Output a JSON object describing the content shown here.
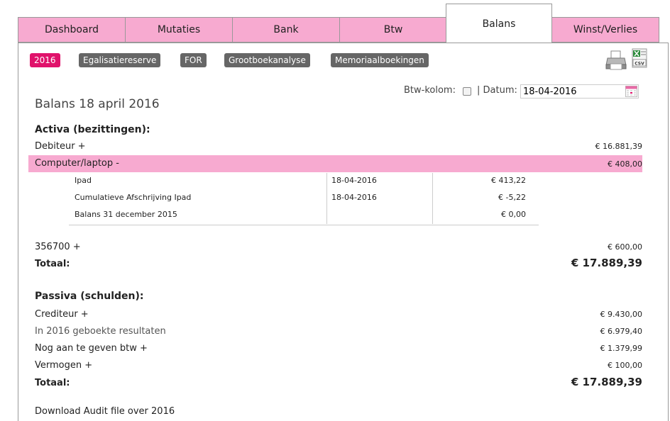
{
  "tabs": [
    "Dashboard",
    "Mutaties",
    "Bank",
    "Btw",
    "Balans",
    "Winst/Verlies"
  ],
  "active_tab": "Balans",
  "pills": [
    "2016",
    "Egalisatiereserve",
    "FOR",
    "Grootboekanalyse",
    "Memoriaalboekingen"
  ],
  "active_pill": "2016",
  "filters": {
    "btw_label": "Btw-kolom:",
    "datum_label": "| Datum:",
    "date_value": "18-04-2016"
  },
  "page_title": "Balans 18 april 2016",
  "activa": {
    "heading": "Activa (bezittingen):",
    "debiteur": {
      "label": "Debiteur +",
      "amount": "€ 16.881,39"
    },
    "computer": {
      "label": "Computer/laptop -",
      "amount": "€ 408,00"
    },
    "sub_rows": [
      {
        "name": "Ipad",
        "date": "18-04-2016",
        "amount": "€ 413,22"
      },
      {
        "name": "Cumulatieve Afschrijving Ipad",
        "date": "18-04-2016",
        "amount": "€ -5,22"
      },
      {
        "name": "Balans 31 december 2015",
        "date": "",
        "amount": "€ 0,00"
      }
    ],
    "account_356700": {
      "label": "356700 +",
      "amount": "€ 600,00"
    },
    "total": {
      "label": "Totaal:",
      "amount": "€ 17.889,39"
    }
  },
  "passiva": {
    "heading": "Passiva (schulden):",
    "crediteur": {
      "label": "Crediteur +",
      "amount": "€ 9.430,00"
    },
    "resultaten": {
      "label": "In 2016 geboekte resultaten",
      "amount": "€ 6.979,40"
    },
    "btw": {
      "label": "Nog aan te geven btw +",
      "amount": "€ 1.379,99"
    },
    "vermogen": {
      "label": "Vermogen +",
      "amount": "€ 100,00"
    },
    "total": {
      "label": "Totaal:",
      "amount": "€ 17.889,39"
    }
  },
  "download_link": "Download Audit file over 2016",
  "colors": {
    "tab_pink": "#f7aad0",
    "accent": "#e0126b",
    "pill_grey": "#666666"
  },
  "icons": [
    "printer-icon",
    "csv-export-icon",
    "calendar-icon"
  ]
}
